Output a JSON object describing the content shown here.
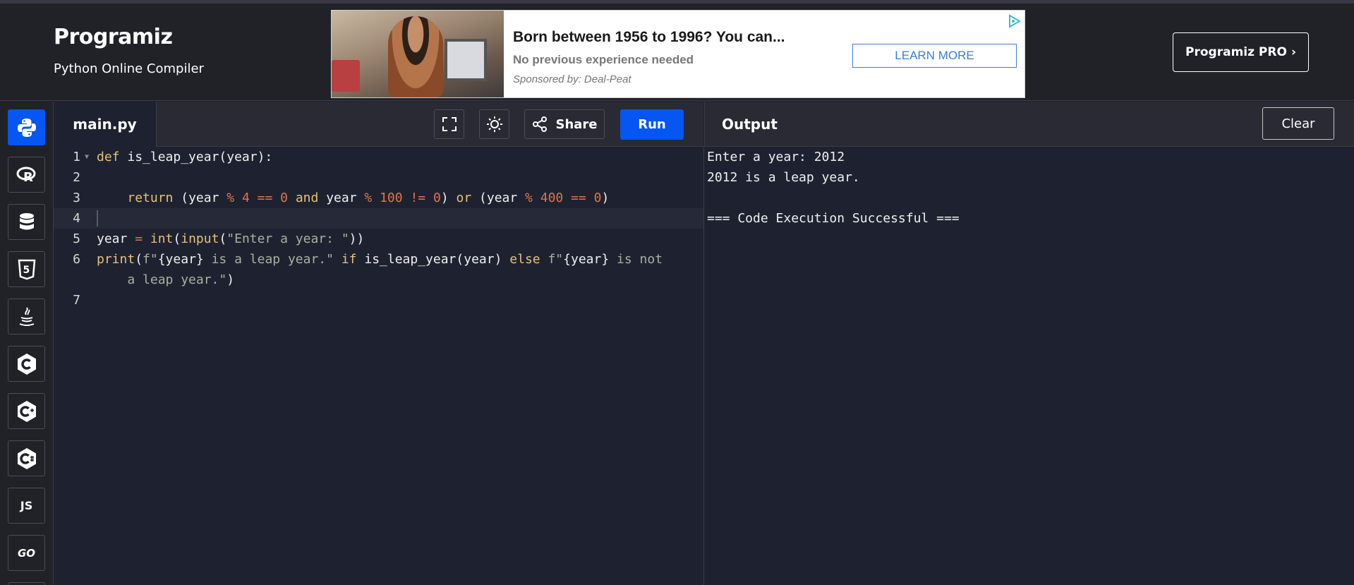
{
  "header": {
    "logo_text": "Programiz",
    "subtitle": "Python Online Compiler",
    "pro_button": "Programiz PRO",
    "pro_chevron": "›"
  },
  "ad": {
    "title": "Born between 1956 to 1996? You can...",
    "subtitle": "No previous experience needed",
    "sponsor": "Sponsored by: Deal-Peat",
    "cta": "LEARN MORE"
  },
  "languages": [
    {
      "id": "python",
      "label": "",
      "icon": "python-icon",
      "active": true
    },
    {
      "id": "r",
      "label": "R",
      "icon": "r-icon",
      "active": false
    },
    {
      "id": "sql",
      "label": "",
      "icon": "database-icon",
      "active": false
    },
    {
      "id": "html",
      "label": "5",
      "icon": "html5-icon",
      "active": false
    },
    {
      "id": "java",
      "label": "",
      "icon": "java-icon",
      "active": false
    },
    {
      "id": "c",
      "label": "C",
      "icon": "c-icon",
      "active": false
    },
    {
      "id": "cpp",
      "label": "C",
      "icon": "cpp-icon",
      "active": false
    },
    {
      "id": "csharp",
      "label": "C",
      "icon": "csharp-icon",
      "active": false
    },
    {
      "id": "js",
      "label": "JS",
      "icon": "js-icon",
      "active": false
    },
    {
      "id": "go",
      "label": "GO",
      "icon": "go-icon",
      "active": false
    }
  ],
  "editor": {
    "file_tab": "main.py",
    "share_label": "Share",
    "run_label": "Run",
    "line_numbers": [
      "1",
      "2",
      "3",
      "4",
      "5",
      "6",
      "",
      "7"
    ]
  },
  "output": {
    "title": "Output",
    "clear_label": "Clear",
    "lines": [
      "Enter a year: 2012",
      "2012 is a leap year.",
      "",
      "=== Code Execution Successful ==="
    ]
  },
  "colors": {
    "accent": "#0556f3",
    "background": "#1e2230",
    "header": "#212227",
    "keyword": "#e6c07b",
    "number": "#e0734a",
    "string": "#a8b0a0"
  }
}
